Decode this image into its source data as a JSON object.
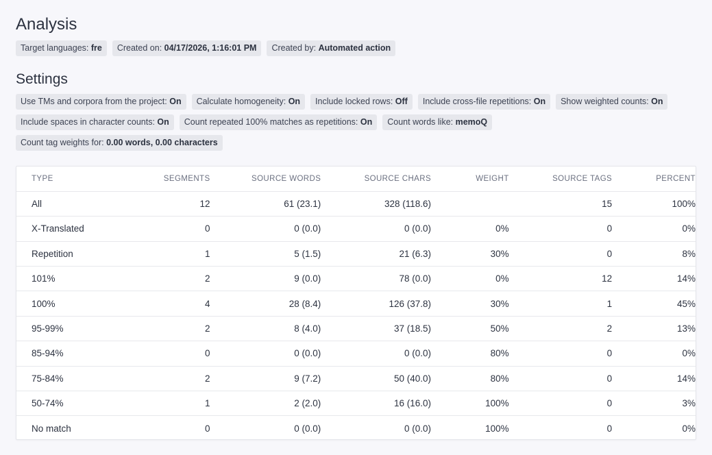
{
  "header": {
    "title": "Analysis",
    "meta": [
      {
        "label": "Target languages: ",
        "value": "fre"
      },
      {
        "label": "Created on: ",
        "value": "04/17/2026, 1:16:01 PM"
      },
      {
        "label": "Created by: ",
        "value": "Automated action"
      }
    ]
  },
  "settings": {
    "title": "Settings",
    "row1": [
      {
        "label": "Use TMs and corpora from the project: ",
        "value": "On"
      },
      {
        "label": "Calculate homogeneity: ",
        "value": "On"
      },
      {
        "label": "Include locked rows: ",
        "value": "Off"
      },
      {
        "label": "Include cross-file repetitions: ",
        "value": "On"
      },
      {
        "label": "Show weighted counts: ",
        "value": "On"
      }
    ],
    "row2": [
      {
        "label": "Include spaces in character counts: ",
        "value": "On"
      },
      {
        "label": "Count repeated 100% matches as repetitions: ",
        "value": "On"
      },
      {
        "label": "Count words like: ",
        "value": "memoQ"
      }
    ],
    "row3": [
      {
        "label": "Count tag weights for: ",
        "value": "0.00 words, 0.00 characters"
      }
    ]
  },
  "table": {
    "headers": [
      "TYPE",
      "SEGMENTS",
      "SOURCE WORDS",
      "SOURCE CHARS",
      "WEIGHT",
      "SOURCE TAGS",
      "PERCENT"
    ],
    "rows": [
      [
        "All",
        "12",
        "61 (23.1)",
        "328 (118.6)",
        "",
        "15",
        "100%"
      ],
      [
        "X-Translated",
        "0",
        "0 (0.0)",
        "0 (0.0)",
        "0%",
        "0",
        "0%"
      ],
      [
        "Repetition",
        "1",
        "5 (1.5)",
        "21 (6.3)",
        "30%",
        "0",
        "8%"
      ],
      [
        "101%",
        "2",
        "9 (0.0)",
        "78 (0.0)",
        "0%",
        "12",
        "14%"
      ],
      [
        "100%",
        "4",
        "28 (8.4)",
        "126 (37.8)",
        "30%",
        "1",
        "45%"
      ],
      [
        "95-99%",
        "2",
        "8 (4.0)",
        "37 (18.5)",
        "50%",
        "2",
        "13%"
      ],
      [
        "85-94%",
        "0",
        "0 (0.0)",
        "0 (0.0)",
        "80%",
        "0",
        "0%"
      ],
      [
        "75-84%",
        "2",
        "9 (7.2)",
        "50 (40.0)",
        "80%",
        "0",
        "14%"
      ],
      [
        "50-74%",
        "1",
        "2 (2.0)",
        "16 (16.0)",
        "100%",
        "0",
        "3%"
      ],
      [
        "No match",
        "0",
        "0 (0.0)",
        "0 (0.0)",
        "100%",
        "0",
        "0%"
      ]
    ]
  }
}
